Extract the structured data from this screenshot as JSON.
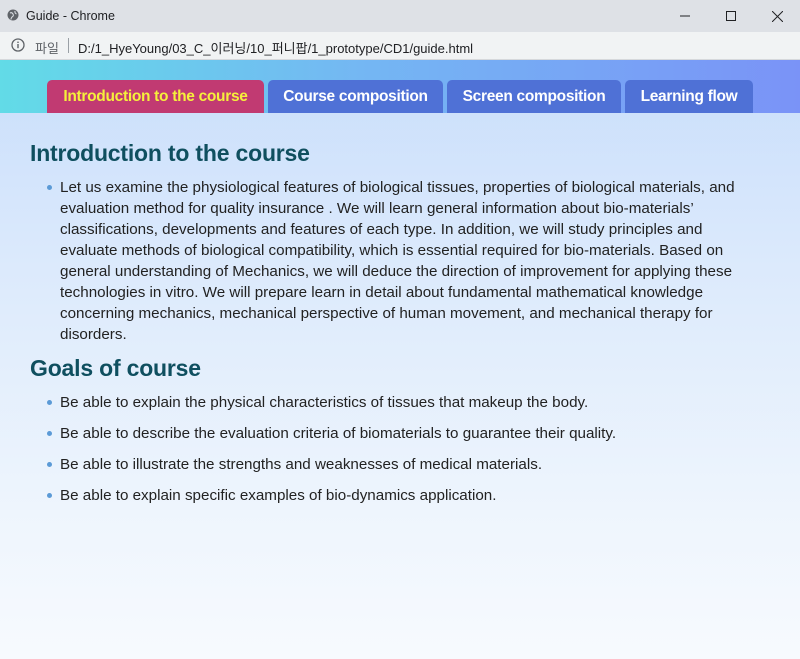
{
  "window": {
    "title": "Guide - Chrome",
    "controls": {
      "minimize": "minimize",
      "maximize": "maximize",
      "close": "close"
    }
  },
  "address_bar": {
    "scheme_label": "파일",
    "url": "D:/1_HyeYoung/03_C_이러닝/10_퍼니팝/1_prototype/CD1/guide.html"
  },
  "tabs": [
    {
      "label": "Introduction to the course",
      "active": true
    },
    {
      "label": "Course composition",
      "active": false
    },
    {
      "label": "Screen composition",
      "active": false
    },
    {
      "label": "Learning flow",
      "active": false
    }
  ],
  "colors": {
    "active_tab_bg": "#c13a72",
    "active_tab_text": "#f5f03b",
    "tab_bg": "#4f71d6",
    "heading": "#0f4f5f",
    "bullet": "#5b9ad6"
  },
  "intro": {
    "heading": "Introduction to the course",
    "text": "Let us examine the physiological features of biological tissues, properties of biological materials, and evaluation method for quality insurance . We will learn general information about bio-materials’ classifications, developments and features of each type. In addition, we will study principles and evaluate methods of biological compatibility, which is essential required for bio-materials. Based on general understanding of Mechanics, we will deduce the direction of improvement for applying these technologies in vitro. We will prepare learn in detail about fundamental mathematical knowledge concerning mechanics, mechanical perspective of human movement, and mechanical therapy for disorders."
  },
  "goals": {
    "heading": "Goals of course",
    "items": [
      "Be able to explain the physical characteristics of tissues that makeup the body.",
      "Be able to describe the evaluation criteria of biomaterials to guarantee their quality.",
      "Be able to illustrate the strengths and weaknesses of medical materials.",
      "Be able to explain specific examples of bio-dynamics application."
    ]
  }
}
